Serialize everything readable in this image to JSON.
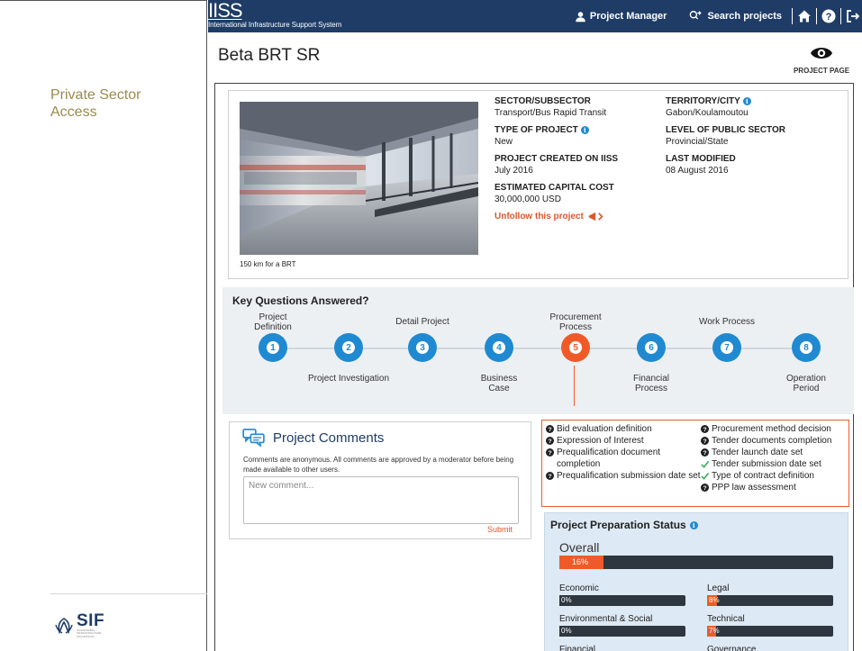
{
  "sidebar": {
    "access_link": "Private Sector Access",
    "logo_text": "SIF",
    "logo_subtext": "SUSTAINABLE INFRASTRUCTURE FOUNDATION"
  },
  "header": {
    "brand": "IISS",
    "brand_subtitle": "International Infrastructure Support System",
    "user_menu": "Project Manager",
    "search_label": "Search projects",
    "icons": [
      "user-icon",
      "search-icon",
      "home-icon",
      "help-icon",
      "logout-icon"
    ]
  },
  "page": {
    "title": "Beta BRT SR",
    "project_page_label": "PROJECT PAGE"
  },
  "project_info": {
    "photo_caption": "150 km for a BRT",
    "sector_label": "SECTOR/SUBSECTOR",
    "sector_value": "Transport/Bus Rapid Transit",
    "type_label": "TYPE OF PROJECT",
    "type_value": "New",
    "created_label": "PROJECT CREATED ON IISS",
    "created_value": "July 2016",
    "capex_label": "ESTIMATED CAPITAL COST",
    "capex_value": "30,000,000 USD",
    "territory_label": "TERRITORY/CITY",
    "territory_value": "Gabon/Koulamoutou",
    "level_label": "LEVEL OF PUBLIC SECTOR",
    "level_value": "Provincial/State",
    "modified_label": "LAST MODIFIED",
    "modified_value": "08 August 2016",
    "unfollow_label": "Unfollow this project"
  },
  "key_questions": {
    "title": "Key Questions Answered?",
    "active_step": 5,
    "steps": [
      {
        "number": "1",
        "label": "Project Definition"
      },
      {
        "number": "2",
        "label": "Project Investigation"
      },
      {
        "number": "3",
        "label": "Detail Project"
      },
      {
        "number": "4",
        "label": "Business Case"
      },
      {
        "number": "5",
        "label": "Procurement Process"
      },
      {
        "number": "6",
        "label": "Financial Process"
      },
      {
        "number": "7",
        "label": "Work Process"
      },
      {
        "number": "8",
        "label": "Operation Period"
      }
    ]
  },
  "comments": {
    "title": "Project Comments",
    "note": "Comments are anonymous. All comments are approved by a moderator before being made available to other users.",
    "placeholder": "New comment...",
    "submit_label": "Submit"
  },
  "checklist": {
    "left": [
      {
        "label": "Bid evaluation definition",
        "status": "question"
      },
      {
        "label": "Expression of Interest",
        "status": "question"
      },
      {
        "label": "Prequalification document completion",
        "status": "question"
      },
      {
        "label": "Prequalification submission date set",
        "status": "question"
      }
    ],
    "right": [
      {
        "label": "Procurement method decision",
        "status": "question"
      },
      {
        "label": "Tender documents completion",
        "status": "question"
      },
      {
        "label": "Tender launch date set",
        "status": "question"
      },
      {
        "label": "Tender submission date set",
        "status": "done"
      },
      {
        "label": "Type of contract definition",
        "status": "done"
      },
      {
        "label": "PPP law assessment",
        "status": "question"
      }
    ]
  },
  "prep_status": {
    "title": "Project Preparation Status",
    "overall_label": "Overall",
    "overall_pct": 16,
    "overall_text": "16%",
    "items": [
      {
        "label": "Economic",
        "pct": 0,
        "text": "0%"
      },
      {
        "label": "Legal",
        "pct": 8,
        "text": "8%"
      },
      {
        "label": "Environmental & Social",
        "pct": 0,
        "text": "0%"
      },
      {
        "label": "Technical",
        "pct": 7,
        "text": "7%"
      },
      {
        "label": "Financial",
        "pct": 0,
        "text": ""
      },
      {
        "label": "Governance",
        "pct": 0,
        "text": ""
      }
    ]
  },
  "colors": {
    "navy": "#1e3c66",
    "accent_orange": "#f05a28",
    "step_blue": "#1f8ad1",
    "access_link": "#9a8a4f"
  }
}
